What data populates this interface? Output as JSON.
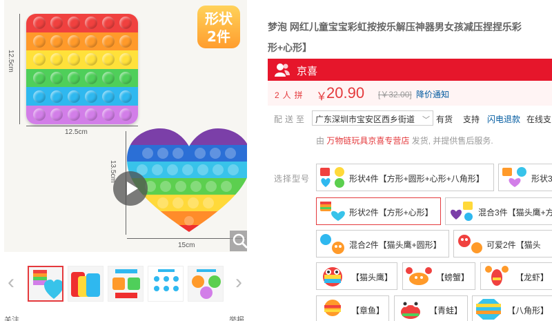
{
  "gallery": {
    "badge_line1": "形状",
    "badge_line2": "2件",
    "dim_square_h": "12.5cm",
    "dim_square_w": "12.5cm",
    "dim_heart_h": "13.5cm",
    "dim_heart_w": "15cm",
    "follow_label": "关注",
    "share_label": "举报",
    "prev_label": "‹",
    "next_label": "›"
  },
  "product": {
    "title_line1": "梦泡 网红儿童宝宝彩虹按按乐解压神器男女孩减压捏捏乐彩",
    "title_line2": "形+心形】"
  },
  "jingxi": {
    "label": "京喜"
  },
  "price": {
    "group_label": "2人拼",
    "currency": "￥",
    "value": "20.90",
    "original": "[￥32.00]",
    "notify": "降价通知"
  },
  "delivery": {
    "label": "配送至",
    "address": "广东深圳市宝安区西乡街道",
    "stock": "有货",
    "support": "支持",
    "flash_refund": "闪电退款",
    "online_pay": "在线支"
  },
  "seller": {
    "prefix": "由",
    "shop": "万物链玩具京喜专营店",
    "suffix": "发货, 并提供售后服务."
  },
  "variants": {
    "label": "选择型号",
    "options": [
      {
        "label": "形状4件【方形+圆形+心形+八角形】"
      },
      {
        "label": "形状3"
      },
      {
        "label": "形状2件【方形+心形】"
      },
      {
        "label": "混合3件【猫头鹰+方"
      },
      {
        "label": "混合2件【猫头鹰+圆形】"
      },
      {
        "label": "可爱2件【猫头"
      },
      {
        "label": "【猫头鹰】"
      },
      {
        "label": "【螃蟹】"
      },
      {
        "label": "【龙虾】"
      },
      {
        "label": "【章鱼】"
      },
      {
        "label": "【青蛙】"
      },
      {
        "label": "【八角形】"
      }
    ]
  },
  "colors": {
    "accent": "#e4393c",
    "jingxi_bar": "#e6162b",
    "link": "#005aa0"
  }
}
